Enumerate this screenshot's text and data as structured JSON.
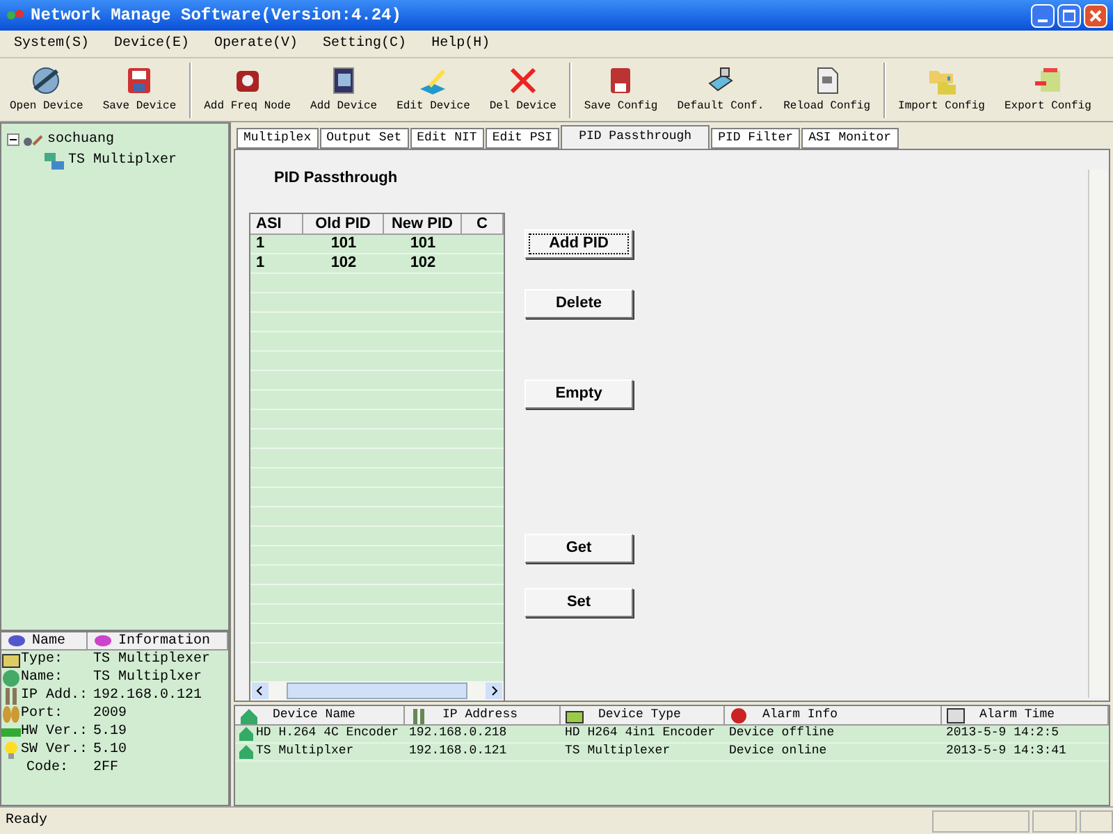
{
  "window": {
    "title": "Network Manage Software(Version:4.24)"
  },
  "menu": [
    "System(S)",
    "Device(E)",
    "Operate(V)",
    "Setting(C)",
    "Help(H)"
  ],
  "toolbar": {
    "groups": [
      [
        "Open Device",
        "Save Device"
      ],
      [
        "Add Freq Node",
        "Add Device",
        "Edit Device",
        "Del Device"
      ],
      [
        "Save Config",
        "Default Conf.",
        "Reload Config"
      ],
      [
        "Import Config",
        "Export Config"
      ]
    ]
  },
  "tree": [
    {
      "label": "sochuang",
      "expanded": true,
      "children": [
        {
          "label": "TS Multiplxer"
        }
      ]
    }
  ],
  "info": {
    "columns": [
      "Name",
      "Information"
    ],
    "rows": [
      {
        "name": "Type:",
        "value": "TS Multiplexer"
      },
      {
        "name": "Name:",
        "value": "TS Multiplxer"
      },
      {
        "name": "IP Add.:",
        "value": "192.168.0.121"
      },
      {
        "name": "Port:",
        "value": "2009"
      },
      {
        "name": "HW Ver.:",
        "value": "5.19"
      },
      {
        "name": "SW Ver.:",
        "value": "5.10"
      },
      {
        "name": "Code:",
        "value": "2FF"
      }
    ]
  },
  "tabs": [
    {
      "label": "Multiplex",
      "selected": false
    },
    {
      "label": "Output Set",
      "selected": false
    },
    {
      "label": "Edit NIT",
      "selected": false
    },
    {
      "label": "Edit PSI",
      "selected": false
    },
    {
      "label": "PID Passthrough",
      "selected": true
    },
    {
      "label": "PID Filter",
      "selected": false
    },
    {
      "label": "ASI Monitor",
      "selected": false
    }
  ],
  "panel": {
    "heading": "PID Passthrough",
    "table": {
      "columns": [
        "ASI",
        "Old PID",
        "New PID",
        "C"
      ],
      "rows": [
        [
          "1",
          "101",
          "101",
          ""
        ],
        [
          "1",
          "102",
          "102",
          ""
        ]
      ]
    },
    "buttons": [
      {
        "label": "Add PID",
        "focused": true
      },
      {
        "label": "Delete",
        "focused": false
      },
      {
        "label": "Empty",
        "focused": false
      },
      {
        "label": "Get",
        "focused": false
      },
      {
        "label": "Set",
        "focused": false
      }
    ]
  },
  "devices": {
    "columns": [
      "Device Name",
      "IP Address",
      "Device Type",
      "Alarm Info",
      "Alarm Time"
    ],
    "rows": [
      [
        "HD H.264 4C Encoder",
        "192.168.0.218",
        "HD H264 4in1 Encoder",
        "Device offline",
        "2013-5-9 14:2:5"
      ],
      [
        "TS Multiplxer",
        "192.168.0.121",
        "TS Multiplexer",
        "Device online",
        "2013-5-9 14:3:41"
      ]
    ]
  },
  "status_bar": {
    "text": "Ready"
  }
}
